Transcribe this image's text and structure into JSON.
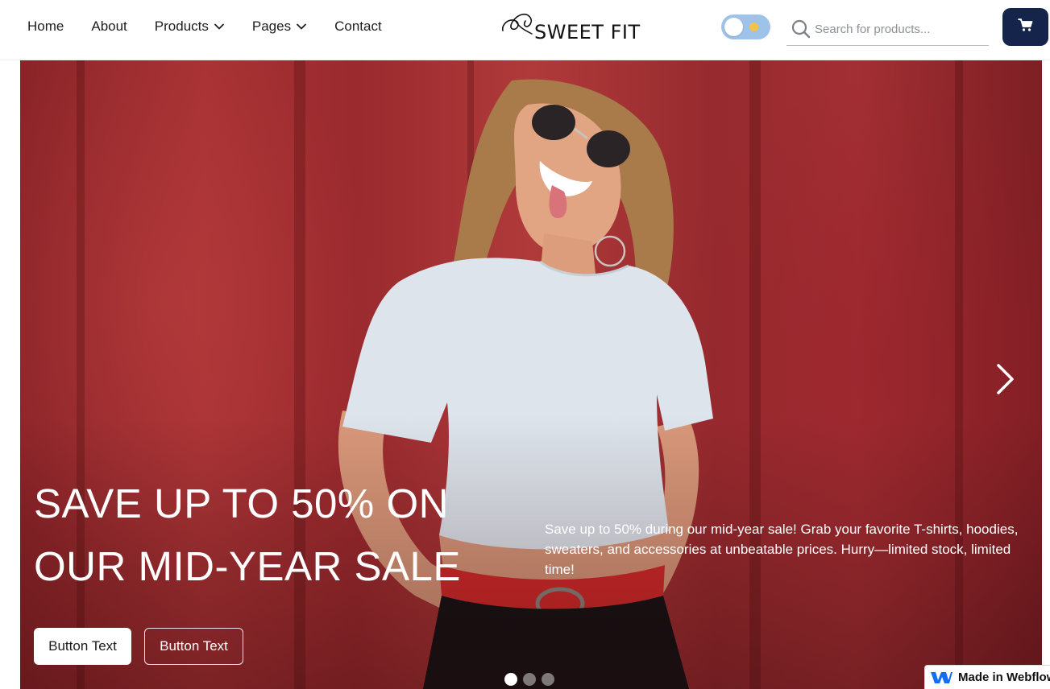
{
  "nav": {
    "items": [
      {
        "label": "Home",
        "dropdown": false
      },
      {
        "label": "About",
        "dropdown": false
      },
      {
        "label": "Products",
        "dropdown": true
      },
      {
        "label": "Pages",
        "dropdown": true
      },
      {
        "label": "Contact",
        "dropdown": false
      }
    ]
  },
  "brand": {
    "name": "SWEET FIT"
  },
  "theme_toggle": {
    "state": "off",
    "icon": "sun-icon",
    "track_color": "#9ec2e8"
  },
  "search": {
    "placeholder": "Search for products...",
    "value": "",
    "icon": "search-icon"
  },
  "cart": {
    "icon": "cart-icon",
    "color": "#14244a"
  },
  "hero": {
    "heading": "SAVE UP TO 50% ON OUR MID-YEAR SALE",
    "description": "Save up to 50% during our mid-year sale! Grab your favorite T-shirts, hoodies, sweaters, and accessories at unbeatable prices. Hurry—limited stock, limited time!",
    "primary_button": "Button Text",
    "secondary_button": "Button Text",
    "next_icon": "chevron-right-icon",
    "slides_total": 3,
    "active_slide": 1,
    "background_color": "#a73234"
  },
  "badge": {
    "label": "Made in Webflow",
    "icon": "webflow-icon"
  }
}
